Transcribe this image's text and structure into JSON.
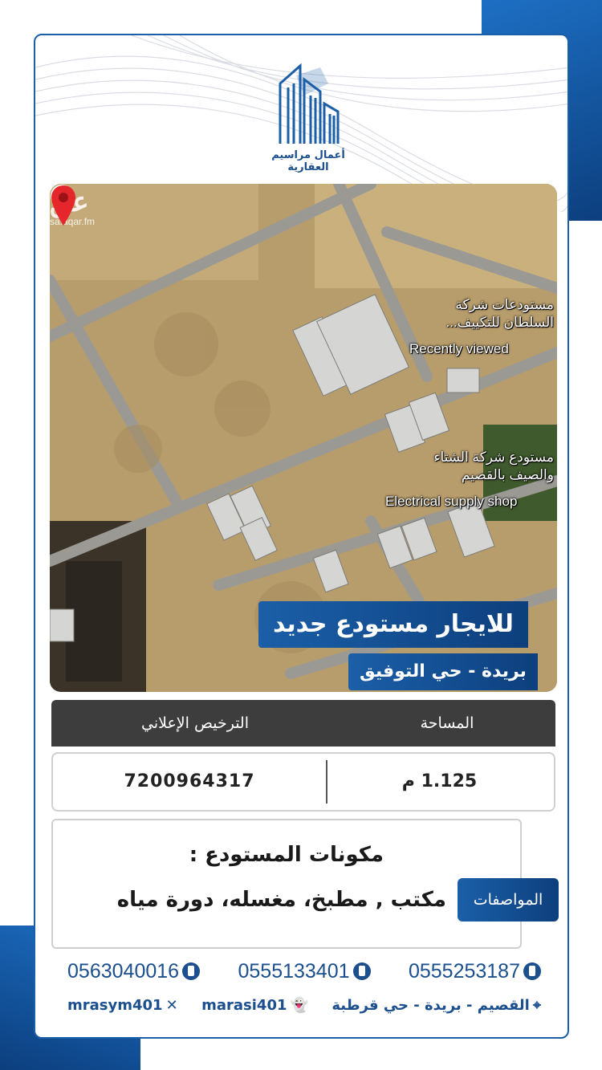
{
  "brand": {
    "name": "أعمال مراسيم العقارية",
    "colors": {
      "primary": "#1b5fa8",
      "dark": "#0d3f7d",
      "header_gray": "#3d3d3d"
    }
  },
  "map": {
    "watermark_logo": "عق",
    "watermark_url": "sa.aqar.fm",
    "place_1_name": "مستودعات شركة السلطان للتكييف...",
    "place_1_subtitle": "Recently viewed",
    "place_2_name": "مستودع شركة الشتاء والصيف بالقصيم",
    "place_2_subtitle": "Electrical supply shop"
  },
  "listing": {
    "title": "للايجار مستودع جديد",
    "location": "بريدة - حي التوفيق"
  },
  "details_table": {
    "headers": {
      "area": "المساحة",
      "license": "الترخيص الإعلاني"
    },
    "values": {
      "area": "1.125 م",
      "license": "7200964317"
    }
  },
  "specs": {
    "tab_label": "المواصفات",
    "heading": "مكونات المستودع :",
    "items": "مكتب , مطبخ، مغسله، دورة مياه"
  },
  "contact": {
    "phones": [
      "0555253187",
      "0555133401",
      "0563040016"
    ],
    "address": "القصيم - بريدة - حي قرطبة",
    "snapchat": "marasi401",
    "x_handle": "mrasym401"
  }
}
